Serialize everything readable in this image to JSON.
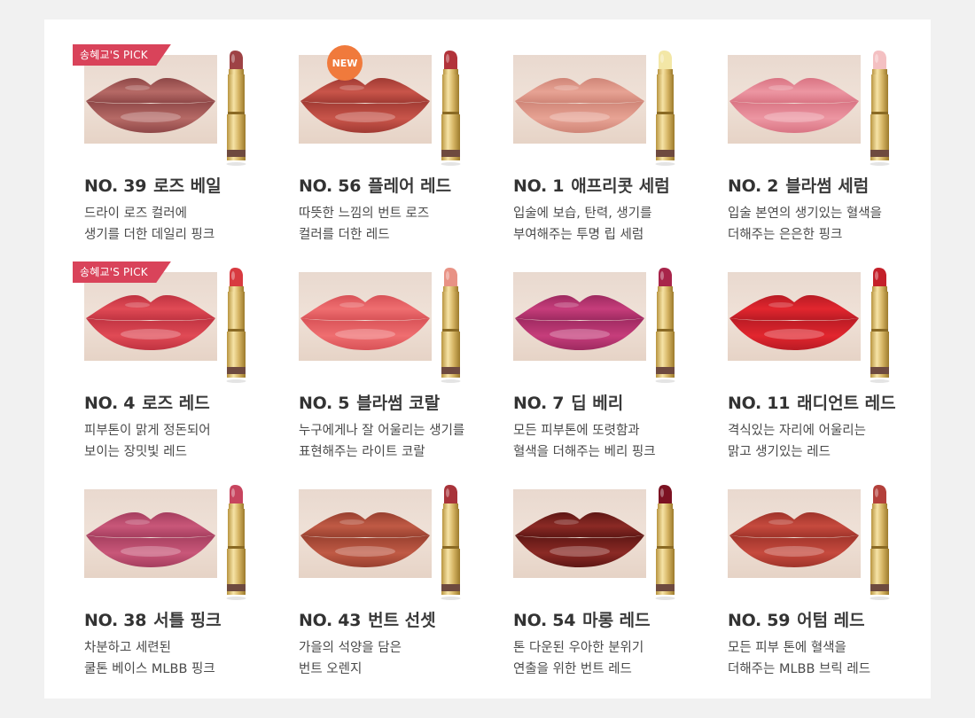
{
  "products": [
    {
      "number": "NO. 39",
      "name": "로즈 베일",
      "line1": "드라이 로즈 컬러에",
      "line2": "생기를 더한 데일리 핑크",
      "badge": "송혜교'S PICK",
      "badge_type": "pick",
      "lip_color": "#b66a66",
      "lip_dark": "#8e4747",
      "bullet_color": "#9e4245"
    },
    {
      "number": "NO. 56",
      "name": "플레어 레드",
      "line1": "따뜻한 느낌의 번트 로즈",
      "line2": "컬러를 더한 레드",
      "badge": "NEW",
      "badge_type": "new",
      "lip_color": "#c9554a",
      "lip_dark": "#a03a33",
      "bullet_color": "#b2333a"
    },
    {
      "number": "NO. 1",
      "name": "애프리콧 세럼",
      "line1": "입술에 보습, 탄력, 생기를",
      "line2": "부여해주는 투명 립 세럼",
      "badge": "",
      "badge_type": "",
      "lip_color": "#e7a394",
      "lip_dark": "#cf8577",
      "bullet_color": "#f3e7a6"
    },
    {
      "number": "NO. 2",
      "name": "블라썸 세럼",
      "line1": "입술 본연의 생기있는 혈색을",
      "line2": "더해주는 은은한 핑크",
      "badge": "",
      "badge_type": "",
      "lip_color": "#ec96a2",
      "lip_dark": "#d97483",
      "bullet_color": "#f4c0c2"
    },
    {
      "number": "NO. 4",
      "name": "로즈 레드",
      "line1": "피부톤이 맑게 정돈되어",
      "line2": "보이는 장밋빛 레드",
      "badge": "송혜교'S PICK",
      "badge_type": "pick",
      "lip_color": "#e04a55",
      "lip_dark": "#c03341",
      "bullet_color": "#d83a40"
    },
    {
      "number": "NO. 5",
      "name": "블라썸 코랄",
      "line1": "누구에게나 잘 어울리는 생기를",
      "line2": "표현해주는 라이트 코랄",
      "badge": "",
      "badge_type": "",
      "lip_color": "#ef6e70",
      "lip_dark": "#d85257",
      "bullet_color": "#e89285"
    },
    {
      "number": "NO. 7",
      "name": "딥 베리",
      "line1": "모든 피부톤에 또렷함과",
      "line2": "혈색을 더해주는 베리 핑크",
      "badge": "",
      "badge_type": "",
      "lip_color": "#c63d7b",
      "lip_dark": "#9e2a60",
      "bullet_color": "#a8244a"
    },
    {
      "number": "NO. 11",
      "name": "래디언트 레드",
      "line1": "격식있는 자리에 어울리는",
      "line2": "맑고 생기있는 레드",
      "badge": "",
      "badge_type": "",
      "lip_color": "#e2262e",
      "lip_dark": "#b81b24",
      "bullet_color": "#c4202a"
    },
    {
      "number": "NO. 38",
      "name": "서틀 핑크",
      "line1": "차분하고 세련된",
      "line2": "쿨톤 베이스 MLBB 핑크",
      "badge": "",
      "badge_type": "",
      "lip_color": "#c95779",
      "lip_dark": "#a53e5f",
      "bullet_color": "#c7445e"
    },
    {
      "number": "NO. 43",
      "name": "번트 선셋",
      "line1": "가을의 석양을 담은",
      "line2": "번트 오렌지",
      "badge": "",
      "badge_type": "",
      "lip_color": "#c05a45",
      "lip_dark": "#98402f",
      "bullet_color": "#a8333a"
    },
    {
      "number": "NO. 54",
      "name": "마롱 레드",
      "line1": "톤 다운된 우아한 분위기",
      "line2": "연출을 위한 번트 레드",
      "badge": "",
      "badge_type": "",
      "lip_color": "#8b2a25",
      "lip_dark": "#5e1714",
      "bullet_color": "#7c1222"
    },
    {
      "number": "NO. 59",
      "name": "어텀 레드",
      "line1": "모든 피부 톤에 혈색을",
      "line2": "더해주는 MLBB 브릭 레드",
      "badge": "",
      "badge_type": "",
      "lip_color": "#c64a3e",
      "lip_dark": "#9f342a",
      "bullet_color": "#b3403b"
    }
  ]
}
